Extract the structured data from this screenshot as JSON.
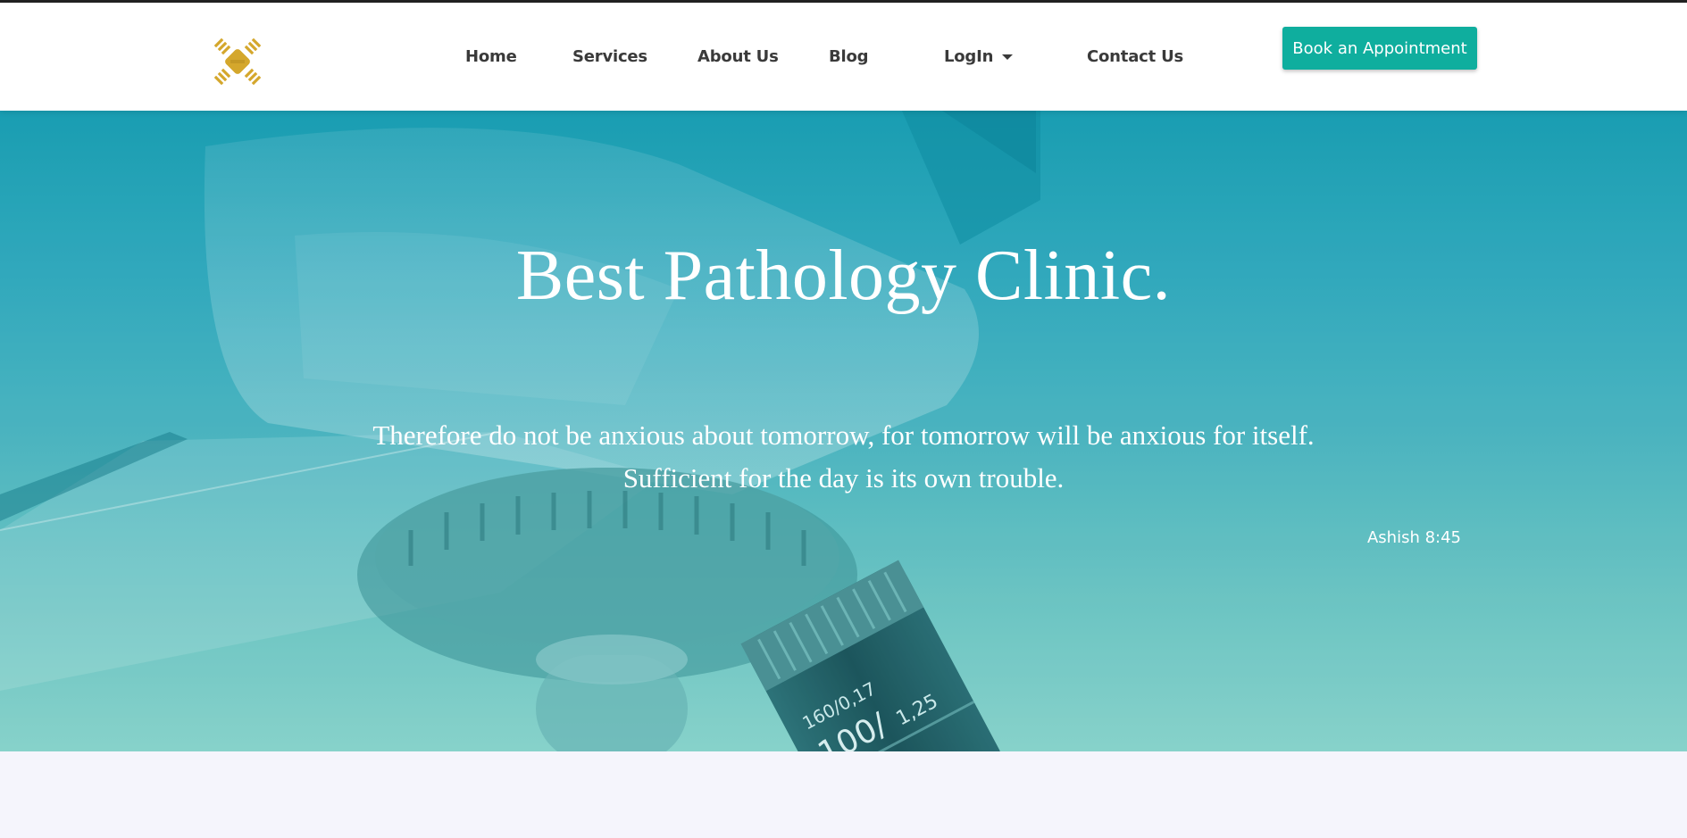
{
  "nav": {
    "items": [
      {
        "label": "Home"
      },
      {
        "label": "Services"
      },
      {
        "label": "About Us"
      },
      {
        "label": "Blog"
      },
      {
        "label": "LogIn"
      },
      {
        "label": "Contact Us"
      }
    ],
    "cta_label": "Book an Appointment"
  },
  "hero": {
    "title": "Best Pathology Clinic.",
    "quote_line_1": "Therefore do not be anxious about tomorrow, for tomorrow will be anxious for itself.",
    "quote_line_2": "Sufficient for the day is its own trouble.",
    "citation": "Ashish 8:45",
    "lens_marking_1": "160/0,17",
    "lens_marking_2": "100/",
    "lens_marking_3": "1,25"
  },
  "colors": {
    "accent": "#0fae9e",
    "logo_gold": "#d4a72c",
    "hero_top": "#1a9db2",
    "hero_bottom": "#91d6cc",
    "nav_text": "#3a3a3a",
    "page_background": "#f5f5fc"
  },
  "icons": {
    "logo": "sun-emblem-logo",
    "dropdown": "caret-down-icon"
  }
}
